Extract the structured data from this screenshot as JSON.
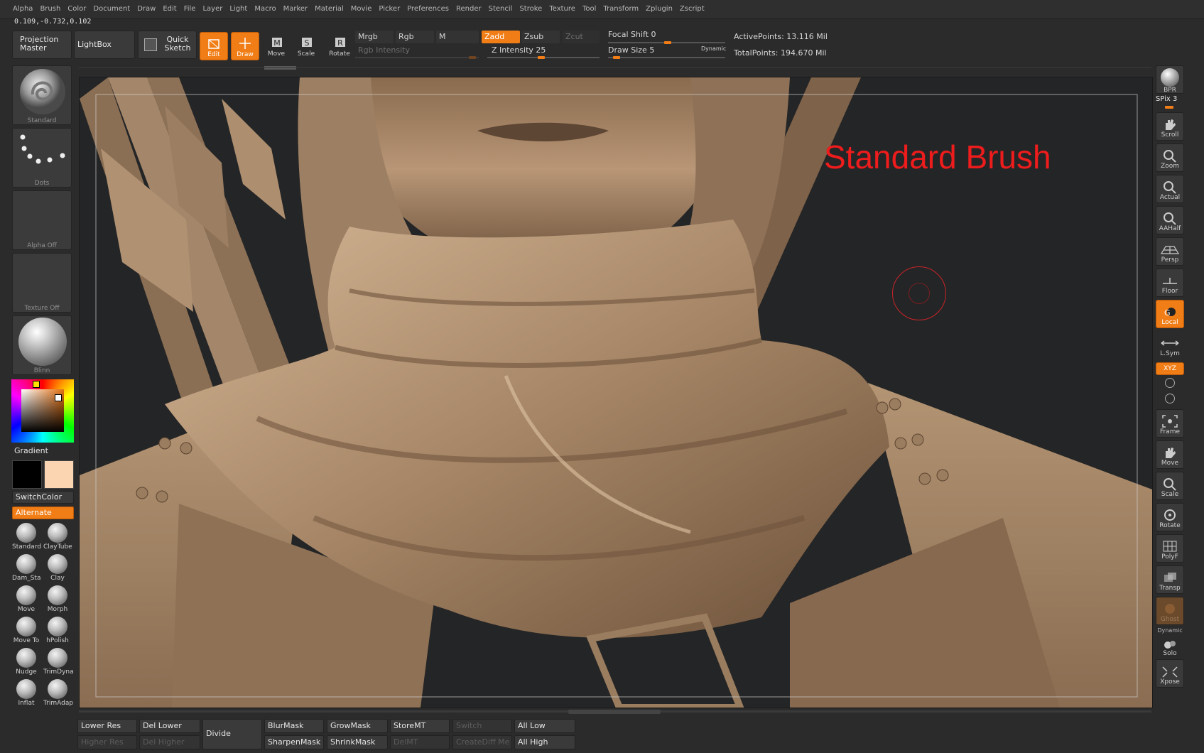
{
  "menu": [
    "Alpha",
    "Brush",
    "Color",
    "Document",
    "Draw",
    "Edit",
    "File",
    "Layer",
    "Light",
    "Macro",
    "Marker",
    "Material",
    "Movie",
    "Picker",
    "Preferences",
    "Render",
    "Stencil",
    "Stroke",
    "Texture",
    "Tool",
    "Transform",
    "Zplugin",
    "Zscript"
  ],
  "coords": "0.109,-0.732,0.102",
  "shelf": {
    "projection_master": "Projection Master",
    "lightbox": "LightBox",
    "quick_sketch": "Quick Sketch",
    "edit": "Edit",
    "draw": "Draw",
    "move": "Move",
    "scale": "Scale",
    "rotate": "Rotate",
    "mrgb": "Mrgb",
    "rgb": "Rgb",
    "m": "M",
    "rgb_intensity": "Rgb Intensity",
    "zadd": "Zadd",
    "zsub": "Zsub",
    "zcut": "Zcut",
    "z_intensity_label": "Z Intensity",
    "z_intensity": "25",
    "focal_shift_label": "Focal Shift",
    "focal_shift": "0",
    "draw_size_label": "Draw Size",
    "draw_size": "5",
    "dynamic": "Dynamic",
    "active_points_label": "ActivePoints:",
    "active_points": "13.116",
    "total_points_label": "TotalPoints:",
    "total_points": "194.670",
    "mil": "Mil"
  },
  "left": {
    "brush_tile": "Standard",
    "stroke_tile": "Dots",
    "alpha_tile": "Alpha Off",
    "texture_tile": "Texture Off",
    "material_tile": "Blinn",
    "gradient": "Gradient",
    "switchcolor": "SwitchColor",
    "alternate": "Alternate",
    "primary_color": "#000000",
    "secondary_color": "#fbd5b2",
    "brushes": [
      "Standard",
      "ClayTube",
      "Dam_Sta",
      "Clay",
      "Move",
      "Morph",
      "Move To",
      "hPolish",
      "Nudge",
      "TrimDyna",
      "Inflat",
      "TrimAdap"
    ]
  },
  "canvas": {
    "annotation": "Standard Brush",
    "annotation_color": "#ee1c1c",
    "cursor_color": "#c8242a"
  },
  "right": {
    "bpr": "BPR",
    "spix_label": "SPix",
    "spix": "3",
    "items": [
      "Scroll",
      "Zoom",
      "Actual",
      "AAHalf",
      "Persp",
      "Floor",
      "Local",
      "L.Sym",
      "XYZ",
      "Frame",
      "Move",
      "Scale",
      "Rotate",
      "PolyF",
      "Transp",
      "Ghost",
      "Solo",
      "Xpose"
    ],
    "dynamic": "Dynamic"
  },
  "bottom": {
    "lower_res": "Lower Res",
    "higher_res": "Higher Res",
    "del_lower": "Del Lower",
    "del_higher": "Del Higher",
    "divide": "Divide",
    "blurmask": "BlurMask",
    "sharpenmask": "SharpenMask",
    "growmask": "GrowMask",
    "shrinkmask": "ShrinkMask",
    "storemt": "StoreMT",
    "delmt": "DelMT",
    "switch": "Switch",
    "creatediff": "CreateDiff Me",
    "all_low": "All Low",
    "all_high": "All High"
  }
}
